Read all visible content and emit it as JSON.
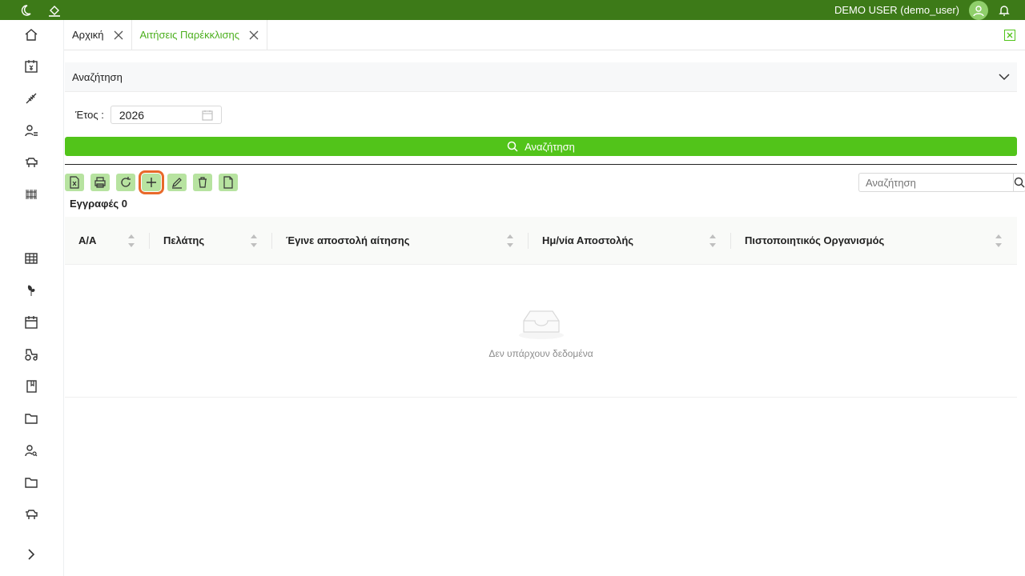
{
  "topbar": {
    "user": "DEMO USER (demo_user)"
  },
  "tabs": [
    {
      "label": "Αρχική"
    },
    {
      "label": "Αιτήσεις Παρέκκλισης"
    }
  ],
  "search_panel": {
    "title": "Αναζήτηση"
  },
  "filters": {
    "year_label": "Έτος :",
    "year_value": "2026"
  },
  "search_button": {
    "label": "Αναζήτηση"
  },
  "grid_search": {
    "placeholder": "Αναζήτηση"
  },
  "records": {
    "label": "Εγγραφές 0"
  },
  "table": {
    "columns": [
      "Α/Α",
      "Πελάτης",
      "Έγινε αποστολή αίτησης",
      "Ημ/νία Αποστολής",
      "Πιστοποιητικός Οργανισμός"
    ],
    "empty_text": "Δεν υπάρχουν δεδομένα"
  },
  "colors": {
    "brand": "#3d7a18",
    "accent": "#52c41a",
    "highlight": "#e8692a"
  }
}
